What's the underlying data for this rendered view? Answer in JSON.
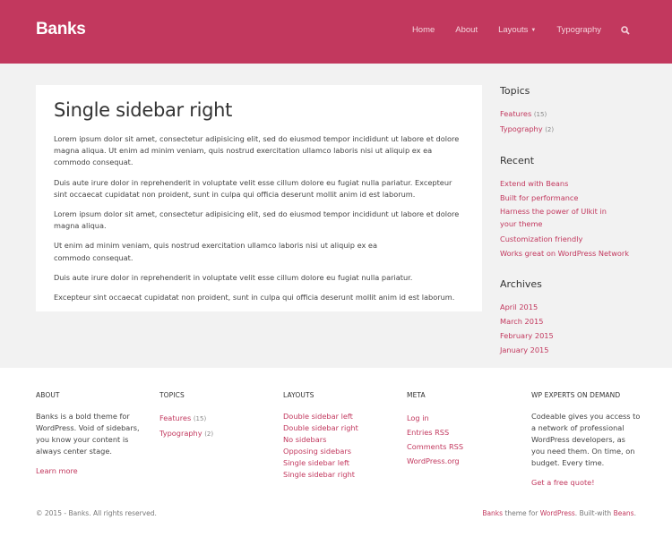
{
  "header": {
    "logo": "Banks",
    "nav": [
      "Home",
      "About",
      "Layouts",
      "Typography"
    ],
    "accent": "#c2385e"
  },
  "main": {
    "title": "Single sidebar right",
    "paragraphs": [
      "Lorem ipsum dolor sit amet, consectetur adipisicing elit, sed do eiusmod tempor incididunt ut labore et dolore magna aliqua. Ut enim ad minim veniam, quis nostrud exercitation ullamco laboris nisi ut aliquip ex ea commodo consequat.",
      "Duis aute irure dolor in reprehenderit in voluptate velit esse cillum dolore eu fugiat nulla pariatur. Excepteur sint occaecat cupidatat non proident, sunt in culpa qui officia deserunt mollit anim id est laborum.",
      "Lorem ipsum dolor sit amet, consectetur adipisicing elit, sed do eiusmod tempor incididunt ut labore et dolore magna aliqua.",
      "Ut enim ad minim veniam, quis nostrud exercitation ullamco laboris nisi ut aliquip ex ea commodo consequat.",
      "Duis aute irure dolor in reprehenderit in voluptate velit esse cillum dolore eu fugiat nulla pariatur.",
      "Excepteur sint occaecat cupidatat non proident, sunt in culpa qui officia deserunt mollit anim id est laborum."
    ]
  },
  "sidebar": {
    "topics_title": "Topics",
    "topics": [
      {
        "label": "Features",
        "count": "(15)"
      },
      {
        "label": "Typography",
        "count": "(2)"
      }
    ],
    "recent_title": "Recent",
    "recent": [
      "Extend with Beans",
      "Built for performance",
      "Harness the power of UIkit in your theme",
      "Customization friendly",
      "Works great on WordPress Network"
    ],
    "archives_title": "Archives",
    "archives": [
      "April 2015",
      "March 2015",
      "February 2015",
      "January 2015"
    ]
  },
  "footer": {
    "about_title": "ABOUT",
    "about_text": "Banks is a bold theme for WordPress. Void of sidebars, you know your content is always center stage.",
    "about_link": "Learn more",
    "topics_title": "TOPICS",
    "topics": [
      {
        "label": "Features",
        "count": "(15)"
      },
      {
        "label": "Typography",
        "count": "(2)"
      }
    ],
    "layouts_title": "LAYOUTS",
    "layouts": [
      "Double sidebar left",
      "Double sidebar right",
      "No sidebars",
      "Opposing sidebars",
      "Single sidebar left",
      "Single sidebar right"
    ],
    "meta_title": "META",
    "meta": [
      "Log in",
      "Entries RSS",
      "Comments RSS",
      "WordPress.org"
    ],
    "wp_title": "WP EXPERTS ON DEMAND",
    "wp_text": "Codeable gives you access to a network of professional WordPress developers, as you need them. On time, on budget. Every time.",
    "wp_link": "Get a free quote!",
    "copyright": "© 2015 - Banks. All rights reserved.",
    "credit_banks": "Banks",
    "credit_mid1": " theme for ",
    "credit_wp": "WordPress",
    "credit_mid2": ". Built-with ",
    "credit_beans": "Beans",
    "credit_end": "."
  }
}
